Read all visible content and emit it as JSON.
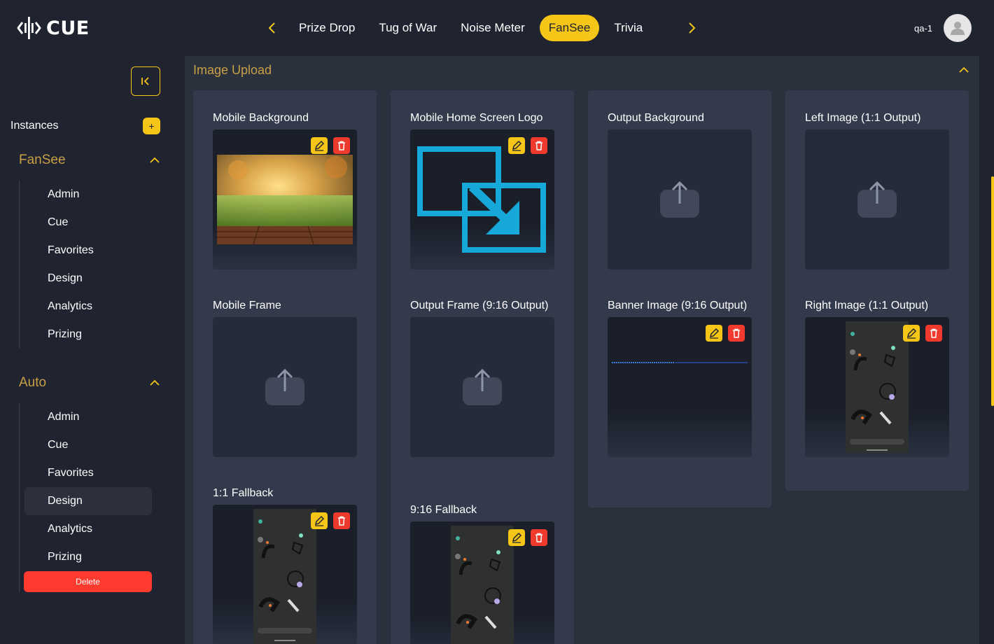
{
  "app": {
    "logo_text": "CUE"
  },
  "nav": {
    "tabs": [
      {
        "label": "Prize Drop",
        "active": false
      },
      {
        "label": "Tug of War",
        "active": false
      },
      {
        "label": "Noise Meter",
        "active": false
      },
      {
        "label": "FanSee",
        "active": true
      },
      {
        "label": "Trivia",
        "active": false
      }
    ],
    "prev_icon": "chevron-left-icon",
    "next_icon": "chevron-right-icon"
  },
  "user": {
    "name": "qa-1",
    "avatar_icon": "user-avatar-icon"
  },
  "sidebar": {
    "instances_label": "Instances",
    "add_label": "+",
    "groups": [
      {
        "title": "FanSee",
        "items": [
          "Admin",
          "Cue",
          "Favorites",
          "Design",
          "Analytics",
          "Prizing"
        ]
      },
      {
        "title": "Auto",
        "items": [
          "Admin",
          "Cue",
          "Favorites",
          "Design",
          "Analytics",
          "Prizing"
        ],
        "selected": "Design"
      }
    ],
    "delete_label": "Delete"
  },
  "section": {
    "title": "Image Upload"
  },
  "fields": {
    "mobile_background": "Mobile Background",
    "mobile_frame": "Mobile Frame",
    "fallback_1_1": "1:1 Fallback",
    "mobile_home_logo": "Mobile Home Screen Logo",
    "output_frame": "Output Frame (9:16 Output)",
    "fallback_9_16": "9:16 Fallback",
    "output_background": "Output Background",
    "banner_image": "Banner Image (9:16 Output)",
    "left_image": "Left Image (1:1 Output)",
    "right_image": "Right Image (1:1 Output)"
  },
  "colors": {
    "accent": "#f5c518",
    "danger": "#f03a2e",
    "section_title": "#c9a045",
    "logo_cyan": "#15a8d8"
  }
}
